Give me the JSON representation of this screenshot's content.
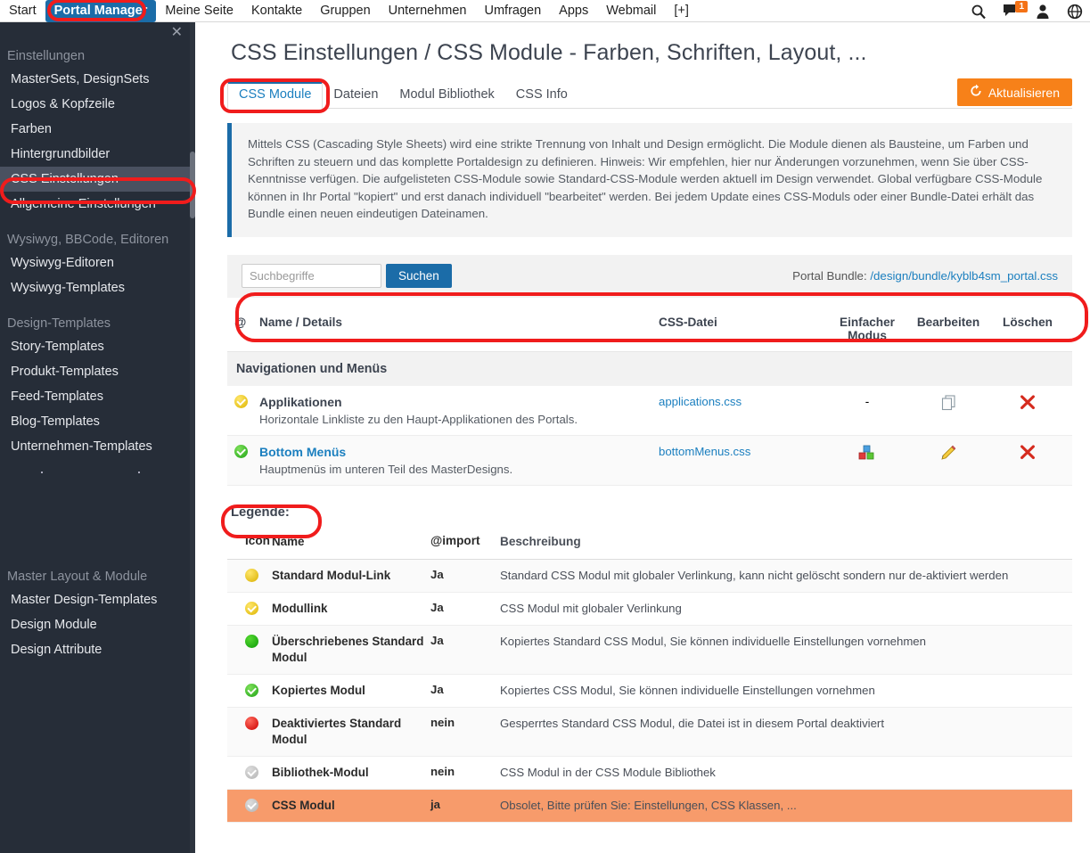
{
  "topnav": {
    "items": [
      {
        "label": "Start",
        "active": false
      },
      {
        "label": "Portal Manager",
        "active": true
      },
      {
        "label": "Meine Seite",
        "active": false
      },
      {
        "label": "Kontakte",
        "active": false
      },
      {
        "label": "Gruppen",
        "active": false
      },
      {
        "label": "Unternehmen",
        "active": false
      },
      {
        "label": "Umfragen",
        "active": false
      },
      {
        "label": "Apps",
        "active": false
      },
      {
        "label": "Webmail",
        "active": false
      },
      {
        "label": "[+]",
        "active": false
      }
    ],
    "icons": [
      "search-icon",
      "messages-icon",
      "user-icon",
      "globe-icon"
    ],
    "message_badge": "1"
  },
  "sidebar": {
    "close_label": "✕",
    "groups": [
      {
        "label": "Einstellungen",
        "items": [
          {
            "label": "MasterSets, DesignSets",
            "selected": false
          },
          {
            "label": "Logos & Kopfzeile",
            "selected": false
          },
          {
            "label": "Farben",
            "selected": false
          },
          {
            "label": "Hintergrundbilder",
            "selected": false
          },
          {
            "label": "CSS Einstellungen",
            "selected": true
          },
          {
            "label": "Allgemeine Einstellungen",
            "selected": false
          }
        ]
      },
      {
        "label": "Wysiwyg, BBCode, Editoren",
        "items": [
          {
            "label": "Wysiwyg-Editoren",
            "selected": false
          },
          {
            "label": "Wysiwyg-Templates",
            "selected": false
          }
        ]
      },
      {
        "label": "Design-Templates",
        "items": [
          {
            "label": "Story-Templates",
            "selected": false
          },
          {
            "label": "Produkt-Templates",
            "selected": false
          },
          {
            "label": "Feed-Templates",
            "selected": false
          },
          {
            "label": "Blog-Templates",
            "selected": false
          },
          {
            "label": "Unternehmen-Templates",
            "selected": false
          }
        ]
      },
      {
        "label": "Master Layout & Module",
        "items": [
          {
            "label": "Master Design-Templates",
            "selected": false
          },
          {
            "label": "Design Module",
            "selected": false
          },
          {
            "label": "Design Attribute",
            "selected": false
          }
        ]
      }
    ]
  },
  "page": {
    "title": "CSS Einstellungen / CSS Module - Farben, Schriften, Layout, ...",
    "tabs": [
      {
        "label": "CSS Module",
        "active": true
      },
      {
        "label": "Dateien",
        "active": false
      },
      {
        "label": "Modul Bibliothek",
        "active": false
      },
      {
        "label": "CSS Info",
        "active": false
      }
    ],
    "refresh_button": "Aktualisieren",
    "info_text": "Mittels CSS (Cascading Style Sheets) wird eine strikte Trennung von Inhalt und Design ermöglicht. Die Module dienen als Bausteine, um Farben und Schriften zu steuern und das komplette Portaldesign zu definieren. Hinweis: Wir empfehlen, hier nur Änderungen vorzunehmen, wenn Sie über CSS-Kenntnisse verfügen. Die aufgelisteten CSS-Module sowie Standard-CSS-Module werden aktuell im Design verwendet. Global verfügbare CSS-Module können in Ihr Portal \"kopiert\" und erst danach individuell \"bearbeitet\" werden. Bei jedem Update eines CSS-Moduls oder einer Bundle-Datei erhält das Bundle einen neuen eindeutigen Dateinamen."
  },
  "search": {
    "placeholder": "Suchbegriffe",
    "value": "",
    "button_label": "Suchen",
    "bundle_label": "Portal Bundle:",
    "bundle_path": "/design/bundle/kyblb4sm_portal.css"
  },
  "modules_table": {
    "headers": {
      "at": "@",
      "name": "Name / Details",
      "file": "CSS-Datei",
      "mode": "Einfacher Modus",
      "edit": "Bearbeiten",
      "delete": "Löschen"
    },
    "section_title": "Navigationen und Menüs",
    "rows": [
      {
        "status_icon": "yellow-check-icon",
        "name": "Applikationen",
        "name_is_link": false,
        "description": "Horizontale Linkliste zu den Haupt-Applikationen des Portals.",
        "file": "applications.css",
        "mode": "-",
        "mode_icon": "none",
        "edit_icon": "copy-icon",
        "delete_icon": "delete-x-icon"
      },
      {
        "status_icon": "green-check-icon",
        "name": "Bottom Menüs",
        "name_is_link": true,
        "description": "Hauptmenüs im unteren Teil des MasterDesigns.",
        "file": "bottomMenus.css",
        "mode": "",
        "mode_icon": "blocks-icon",
        "edit_icon": "pencil-icon",
        "delete_icon": "delete-x-icon"
      }
    ]
  },
  "legend": {
    "title": "Legende:",
    "headers": {
      "icon": "Icon",
      "name": "Name",
      "import": "@import",
      "description": "Beschreibung"
    },
    "rows": [
      {
        "icon": "yellow-plain-icon",
        "name": "Standard Modul-Link",
        "import": "Ja",
        "description": "Standard CSS Modul mit globaler Verlinkung, kann nicht gelöscht sondern nur de-aktiviert werden",
        "highlight": false
      },
      {
        "icon": "yellow-check-icon",
        "name": "Modullink",
        "import": "Ja",
        "description": "CSS Modul mit globaler Verlinkung",
        "highlight": false
      },
      {
        "icon": "green-plain-icon",
        "name": "Überschriebenes Standard Modul",
        "import": "Ja",
        "description": "Kopiertes Standard CSS Modul, Sie können individuelle Einstellungen vornehmen",
        "highlight": false
      },
      {
        "icon": "green-check-icon",
        "name": "Kopiertes Modul",
        "import": "Ja",
        "description": "Kopiertes CSS Modul, Sie können individuelle Einstellungen vornehmen",
        "highlight": false
      },
      {
        "icon": "red-plain-icon",
        "name": "Deaktiviertes Standard Modul",
        "import": "nein",
        "description": "Gesperrtes Standard CSS Modul, die Datei ist in diesem Portal deaktiviert",
        "highlight": false
      },
      {
        "icon": "grey-check-icon",
        "name": "Bibliothek-Modul",
        "import": "nein",
        "description": "CSS Modul in der CSS Module Bibliothek",
        "highlight": false
      },
      {
        "icon": "grey-check-icon",
        "name": "CSS Modul",
        "import": "ja",
        "description": "Obsolet, Bitte prüfen Sie: Einstellungen, CSS Klassen, ...",
        "highlight": true
      }
    ]
  },
  "colors": {
    "accent_blue": "#1b6ca8",
    "link_blue": "#1b7fbf",
    "orange_button": "#f78119",
    "sidebar_bg": "#262d38",
    "sidebar_selected": "#4a5160",
    "highlight_row": "#f79b6b",
    "annotation_red": "#f01c1c"
  }
}
